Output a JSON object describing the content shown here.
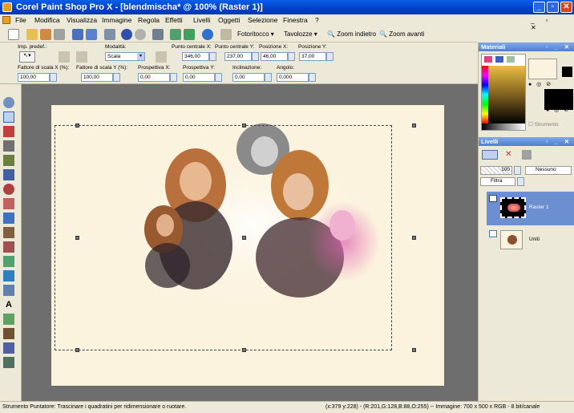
{
  "window": {
    "title": "Corel Paint Shop Pro X - [blendmischa* @ 100% (Raster 1)]",
    "btn_minimize": "_",
    "btn_maximize": "▫",
    "btn_close": "✕"
  },
  "menu": [
    "File",
    "Modifica",
    "Visualizza",
    "Immagine",
    "Regola",
    "Effetti",
    "Livelli",
    "Oggetti",
    "Selezione",
    "Finestra",
    "?"
  ],
  "toolbar": {
    "fotoritocco": "Fotoritocco",
    "tavolozze": "Tavolozze",
    "zoom_indietro": "Zoom indietro",
    "zoom_avanti": "Zoom avanti"
  },
  "options": {
    "imp_predef_label": "Imp. predef.:",
    "modalita_label": "Modalità:",
    "modalita_value": "Scala",
    "punto_centrale_x_label": "Punto centrale X:",
    "punto_centrale_x_value": "346,00",
    "punto_centrale_y_label": "Punto centrale Y:",
    "punto_centrale_y_value": "237,00",
    "posizione_x_label": "Posizione X:",
    "posizione_x_value": "46,00",
    "posizione_y_label": "Posizione Y:",
    "posizione_y_value": "37,00",
    "fattore_x_label": "Fattore di scala X (%):",
    "fattore_x_value": "100,00",
    "fattore_y_label": "Fattore di scala Y (%):",
    "fattore_y_value": "100,00",
    "prospettiva_x_label": "Prospettiva X:",
    "prospettiva_x_value": "0,00",
    "prospettiva_y_label": "Prospettiva Y:",
    "prospettiva_y_value": "0,00",
    "inclinazione_label": "Inclinazione:",
    "inclinazione_value": "0,00",
    "angolo_label": "Angolo:",
    "angolo_value": "0,000"
  },
  "materiali": {
    "title": "Materiali",
    "strumento_label": "Strumento"
  },
  "livelli": {
    "title": "Livelli",
    "opacity_value": "100",
    "blend_value": "Nessuno",
    "filter_value": "Filtra",
    "layers": [
      {
        "name": "Raster 1"
      },
      {
        "name": "Uniti"
      }
    ]
  },
  "status": {
    "left": "Strumento Puntatore: Trascinare i quadratini per ridimensionare o ruotare.",
    "right": "(x:379 y:228) - (R:201,G:128,B:88,O:255) -- Immagine:  700 x 500 x RGB - 8 bit/canale"
  },
  "colors": {
    "titlebar": "#0041c8",
    "canvas_bg": "#fcf3de",
    "workspace_bg": "#6e6e6e",
    "selected_layer": "#6b8fd0"
  }
}
